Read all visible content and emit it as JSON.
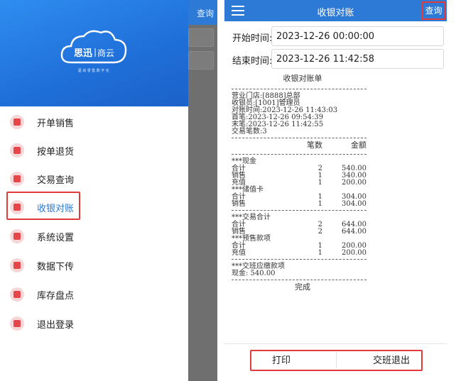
{
  "left": {
    "behind_query": "查询",
    "brand": {
      "name_left": "思迅",
      "name_right": "商云",
      "tagline": "驱动零售数字化"
    },
    "menu": [
      {
        "label": "开单销售",
        "icon": "store-icon"
      },
      {
        "label": "按单退货",
        "icon": "return-icon"
      },
      {
        "label": "交易查询",
        "icon": "transaction-search-icon"
      },
      {
        "label": "收银对账",
        "icon": "cashier-reconcile-icon"
      },
      {
        "label": "系统设置",
        "icon": "gear-icon"
      },
      {
        "label": "数据下传",
        "icon": "cloud-download-icon"
      },
      {
        "label": "库存盘点",
        "icon": "inventory-icon"
      },
      {
        "label": "退出登录",
        "icon": "logout-icon"
      }
    ]
  },
  "right": {
    "title": "收银对账",
    "query_label": "查询",
    "start_label": "开始时间:",
    "start_value": "2023-12-26 00:00:00",
    "end_label": "结束时间:",
    "end_value": "2023-12-26 11:42:58",
    "receipt": {
      "title": "收银对账单",
      "store": "营业门店:[8888]总部",
      "cashier": "收银员:[1001]管理员",
      "recon_time": "对账时间:2023-12-26 11:43:03",
      "first": "首笔:2023-12-26 09:54:39",
      "last": "末笔:2023-12-26 11:42:55",
      "count": "交易笔数:3",
      "col_count": "笔数",
      "col_amount": "金额",
      "cash_title": "***现金",
      "cash_rows": [
        {
          "name": "合计",
          "count": "2",
          "amount": "540.00"
        },
        {
          "name": "销售",
          "count": "1",
          "amount": "340.00"
        },
        {
          "name": "充值",
          "count": "1",
          "amount": "200.00"
        }
      ],
      "card_title": "***储值卡",
      "card_rows": [
        {
          "name": "合计",
          "count": "1",
          "amount": "304.00"
        },
        {
          "name": "销售",
          "count": "1",
          "amount": "304.00"
        }
      ],
      "trade_title": "***交易合计",
      "trade_rows": [
        {
          "name": "合计",
          "count": "2",
          "amount": "644.00"
        },
        {
          "name": "销售",
          "count": "2",
          "amount": "644.00"
        }
      ],
      "prepay_title": "***预售款项",
      "prepay_rows": [
        {
          "name": "合计",
          "count": "1",
          "amount": "200.00"
        },
        {
          "name": "充值",
          "count": "1",
          "amount": "200.00"
        }
      ],
      "handover_title": "***交班应缴款项",
      "handover_cash": "现金: 540.00",
      "done": "完成"
    },
    "print_label": "打印",
    "handover_exit_label": "交班退出"
  }
}
